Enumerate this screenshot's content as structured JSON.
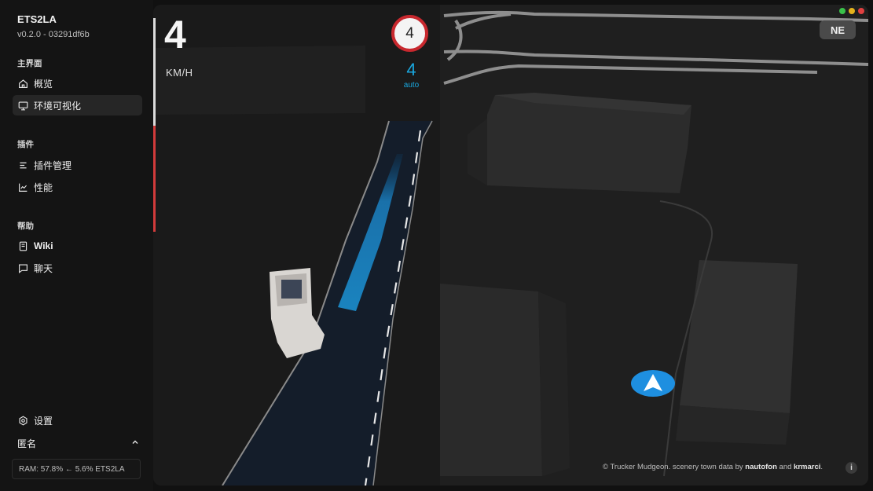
{
  "app": {
    "name": "ETS2LA",
    "version": "v0.2.0 - 03291df6b"
  },
  "sidebar": {
    "sections": [
      {
        "label": "主界面",
        "items": [
          {
            "label": "概览",
            "icon": "home-icon"
          },
          {
            "label": "环境可视化",
            "icon": "monitor-icon",
            "active": true
          }
        ]
      },
      {
        "label": "插件",
        "items": [
          {
            "label": "插件管理",
            "icon": "sliders-icon"
          },
          {
            "label": "性能",
            "icon": "chart-icon"
          }
        ]
      },
      {
        "label": "帮助",
        "items": [
          {
            "label": "Wiki",
            "icon": "book-icon"
          },
          {
            "label": "聊天",
            "icon": "chat-icon"
          }
        ]
      }
    ],
    "settings_label": "设置",
    "user_label": "匿名",
    "ram_status": "RAM: 57.8% ← 5.6% ETS2LA"
  },
  "hud": {
    "speed": "4",
    "speed_unit": "KM/H",
    "speed_limit": "4",
    "set_speed": "4",
    "set_speed_mode": "auto",
    "compass": "NE"
  },
  "attribution": {
    "prefix": "© Trucker Mudgeon. scenery town data by ",
    "author1": "nautofon",
    "middle": " and ",
    "author2": "krmarci",
    "suffix": "."
  },
  "colors": {
    "accent": "#19a8e0",
    "limit_ring": "#c8282e",
    "traffic_green": "#3ac24a",
    "traffic_yellow": "#e4b21c",
    "traffic_red": "#e04040"
  }
}
